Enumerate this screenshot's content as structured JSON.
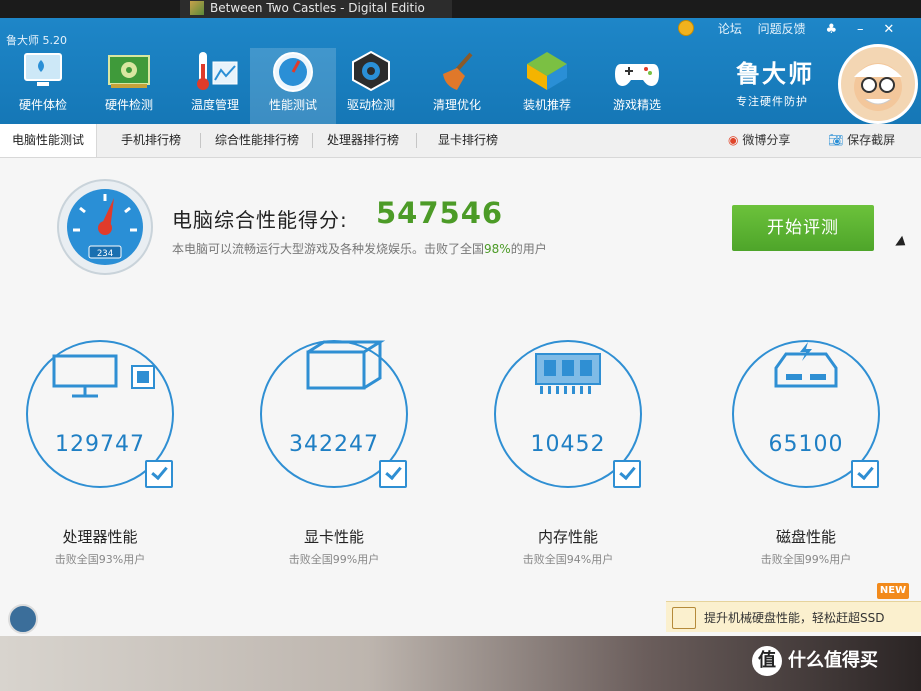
{
  "taskbar": {
    "title": "Between Two Castles - Digital Editio"
  },
  "app": {
    "title": "鲁大师 5.20"
  },
  "toplinks": {
    "forum": "论坛",
    "feedback": "问题反馈"
  },
  "nav": [
    {
      "label": "硬件体检",
      "icon": "hardware-check-icon"
    },
    {
      "label": "硬件检测",
      "icon": "hardware-detect-icon"
    },
    {
      "label": "温度管理",
      "icon": "thermometer-icon"
    },
    {
      "label": "性能测试",
      "icon": "speedometer-icon",
      "active": true
    },
    {
      "label": "驱动检测",
      "icon": "driver-gear-icon"
    },
    {
      "label": "清理优化",
      "icon": "broom-icon"
    },
    {
      "label": "装机推荐",
      "icon": "cube-icon"
    },
    {
      "label": "游戏精选",
      "icon": "gamepad-icon"
    }
  ],
  "brand": {
    "name": "鲁大师",
    "slogan": "专注硬件防护"
  },
  "tabs": [
    {
      "label": "电脑性能测试",
      "active": true
    },
    {
      "label": "手机排行榜"
    },
    {
      "label": "综合性能排行榜"
    },
    {
      "label": "处理器排行榜"
    },
    {
      "label": "显卡排行榜"
    }
  ],
  "share": {
    "weibo": "微博分享",
    "screenshot": "保存截屏"
  },
  "score": {
    "title": "电脑综合性能得分:",
    "value": "547546",
    "desc_prefix": "本电脑可以流畅运行大型游戏及各种发烧娱乐。击败了全国",
    "desc_pct": "98%",
    "desc_suffix": "的用户",
    "gauge_text": "234"
  },
  "start_button": "开始评测",
  "metrics": [
    {
      "label": "处理器性能",
      "value": "129747",
      "sub": "击败全国93%用户",
      "icon": "cpu-monitor-icon"
    },
    {
      "label": "显卡性能",
      "value": "342247",
      "sub": "击败全国99%用户",
      "icon": "gpu-cube-icon"
    },
    {
      "label": "内存性能",
      "value": "10452",
      "sub": "击败全国94%用户",
      "icon": "memory-chip-icon"
    },
    {
      "label": "磁盘性能",
      "value": "65100",
      "sub": "击败全国99%用户",
      "icon": "disk-drive-icon"
    }
  ],
  "ssd_promo": {
    "text": "提升机械硬盘性能，轻松赶超SSD",
    "badge": "NEW"
  },
  "watermark": {
    "text": "什么值得买",
    "icon_glyph": "值"
  },
  "colors": {
    "header": "#1a7fc1",
    "accent_blue": "#2f8fd3",
    "score_green": "#4c9b27",
    "button_green": "#5cb431"
  }
}
